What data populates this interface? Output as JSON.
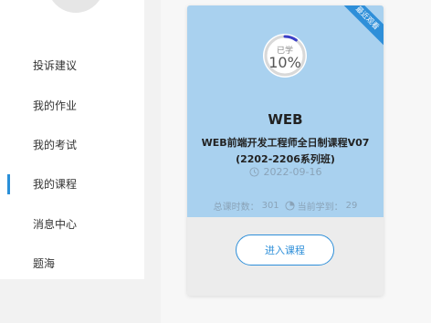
{
  "sidebar": {
    "items": [
      {
        "label": "投诉建议",
        "active": false
      },
      {
        "label": "我的作业",
        "active": false
      },
      {
        "label": "我的考试",
        "active": false
      },
      {
        "label": "我的课程",
        "active": true
      },
      {
        "label": "消息中心",
        "active": false
      },
      {
        "label": "题海",
        "active": false
      }
    ]
  },
  "course_card": {
    "badge": "最近观看",
    "progress_label": "已学",
    "progress_value": "10%",
    "progress_fraction": 0.1,
    "title": "WEB",
    "name": "WEB前端开发工程师全日制课程V07",
    "class_name": "(2202-2206系列班)",
    "date": "2022-09-16",
    "date_icon": "clock-icon",
    "total_hours_label": "总课时数：",
    "total_hours": "301",
    "current_label": "当前学到：",
    "current": "29",
    "current_icon": "pie-progress-icon",
    "enter_label": "进入课程"
  },
  "colors": {
    "accent": "#2e8fd9",
    "card_top": "#a9d1ef",
    "active_indicator": "#2a8fd8"
  }
}
